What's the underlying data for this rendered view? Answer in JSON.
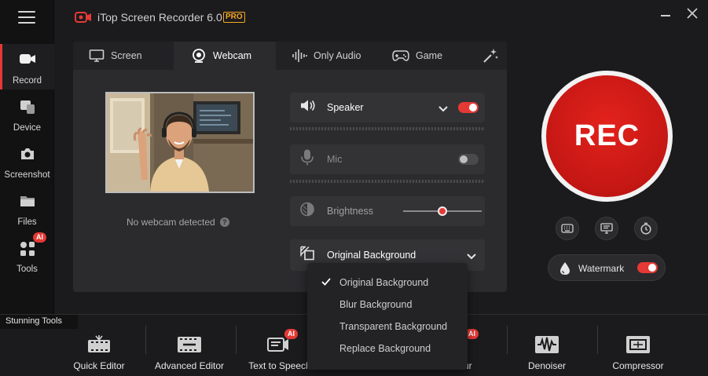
{
  "app": {
    "title": "iTop Screen Recorder 6.0",
    "pro_badge": "PRO"
  },
  "sidebar": {
    "items": [
      {
        "id": "record",
        "label": "Record",
        "icon": "video-camera-icon",
        "active": true
      },
      {
        "id": "device",
        "label": "Device",
        "icon": "device-icon"
      },
      {
        "id": "screenshot",
        "label": "Screenshot",
        "icon": "camera-icon"
      },
      {
        "id": "files",
        "label": "Files",
        "icon": "folder-icon"
      },
      {
        "id": "tools",
        "label": "Tools",
        "icon": "tools-grid-icon",
        "badge": "AI"
      }
    ]
  },
  "tabs": [
    {
      "id": "screen",
      "label": "Screen",
      "icon": "monitor-icon"
    },
    {
      "id": "webcam",
      "label": "Webcam",
      "icon": "webcam-icon",
      "active": true
    },
    {
      "id": "only-audio",
      "label": "Only Audio",
      "icon": "audio-wave-icon"
    },
    {
      "id": "game",
      "label": "Game",
      "icon": "gamepad-icon"
    }
  ],
  "webcam": {
    "status": "No webcam detected"
  },
  "controls": {
    "speaker": {
      "label": "Speaker",
      "enabled": true
    },
    "mic": {
      "label": "Mic",
      "enabled": false
    },
    "brightness": {
      "label": "Brightness",
      "level": 0.5
    },
    "background": {
      "label": "Original Background"
    }
  },
  "background_menu": {
    "options": [
      "Original Background",
      "Blur Background",
      "Transparent Background",
      "Replace Background"
    ],
    "selected": "Original Background"
  },
  "record": {
    "label": "REC",
    "watermark_label": "Watermark",
    "watermark_enabled": true
  },
  "tools": {
    "header": "Stunning Tools",
    "items": [
      {
        "label": "Quick Editor",
        "icon": "film-cut-icon"
      },
      {
        "label": "Advanced Editor",
        "icon": "film-edit-icon"
      },
      {
        "label": "Text to Speech",
        "icon": "text-speech-icon",
        "badge": "AI"
      },
      {
        "label": "ur",
        "icon": "blur-icon",
        "badge": "AI"
      },
      {
        "label": "Denoiser",
        "icon": "denoise-icon"
      },
      {
        "label": "Compressor",
        "icon": "compress-icon"
      }
    ]
  },
  "colors": {
    "accent": "#e53935",
    "pro": "#f5a623",
    "background": "#1b1b1d",
    "panel": "#2b2b2e"
  }
}
